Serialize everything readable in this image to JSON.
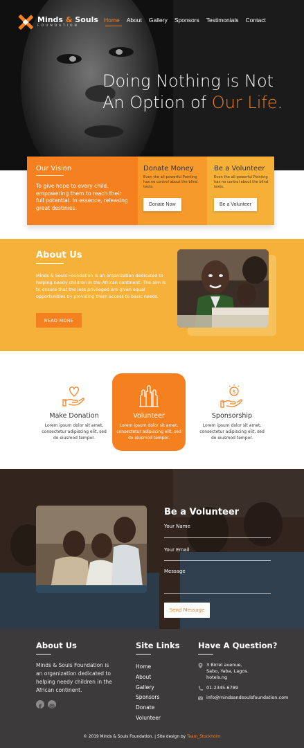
{
  "header": {
    "logo_name_1": "Minds",
    "logo_amp": "&",
    "logo_name_2": "Souls",
    "logo_sub": "FOUNDATION",
    "nav": [
      "Home",
      "About",
      "Gallery",
      "Sponsors",
      "Testimonials",
      "Contact"
    ],
    "active_nav": "Home"
  },
  "hero": {
    "line1": "Doing Nothing is Not",
    "line2_prefix": "An Option of ",
    "line2_highlight": "Our Life",
    "line2_suffix": "."
  },
  "cards": {
    "vision_title": "Our Vision",
    "vision_text": "To give hope to every child, empowering them to reach their full potential. In essence, releasing great destinies.",
    "donate_title": "Donate Money",
    "donate_text": "Even the all-powerful Pointing has no control about the blind texts.",
    "donate_button": "Donate Now",
    "volunteer_title": "Be a Volunteer",
    "volunteer_text": "Even the all-powerful Pointing has no control about the blind texts.",
    "volunteer_button": "Be a Volunteer"
  },
  "about": {
    "title": "About Us",
    "text": "Minds & Souls Foundation is an organization dedicated to helping needy children in the African continent. The aim is to ensure that the less privileged are given equal opportunities by providing them access to basic needs.",
    "button": "READ MORE"
  },
  "services": [
    {
      "title": "Make Donation",
      "text": "Lorem ipsum dolor sit amet, consectetur adipiscing elit, sed do eiusmod tempor.",
      "icon": "heart-hand-icon"
    },
    {
      "title": "Volunteer",
      "text": "Lorem ipsum dolor sit amet, consectetur adipiscing elit, sed do eiusmod tempor.",
      "icon": "raised-hands-icon"
    },
    {
      "title": "Sponsorship",
      "text": "Lorem ipsum dolor sit amet, consectetur adipiscing elit, sed do eiusmod tempor.",
      "icon": "money-hand-icon"
    }
  ],
  "volunteer_form": {
    "title": "Be a Volunteer",
    "name_label": "Your Name",
    "email_label": "Your Email",
    "message_label": "Message",
    "button": "Send Message"
  },
  "footer": {
    "about_title": "About Us",
    "about_text": "Minds & Souls Foundation is an organization dedicated to helping needy children in the African continent.",
    "links_title": "Site Links",
    "links": [
      "Home",
      "About",
      "Gallery",
      "Sponsors",
      "Donate",
      "Volunteer"
    ],
    "contact_title": "Have A Question?",
    "address_1": "3 Birrel avenue,",
    "address_2": "Sabo, Yaba, Lagos.",
    "address_3": "hotels.ng",
    "phone": "01-2345-6789",
    "email": "info@mindsandsoulsfoundation.com",
    "copyright": "© 2019 Minds & Souls Foundation. | Site design by ",
    "credit": "Team_Stockholm"
  },
  "colors": {
    "accent": "#f58020",
    "card_donate": "#f79a2c",
    "card_volunteer": "#f6b037",
    "about_bg": "#f6b13a",
    "footer_bg": "#3c3a3b"
  }
}
